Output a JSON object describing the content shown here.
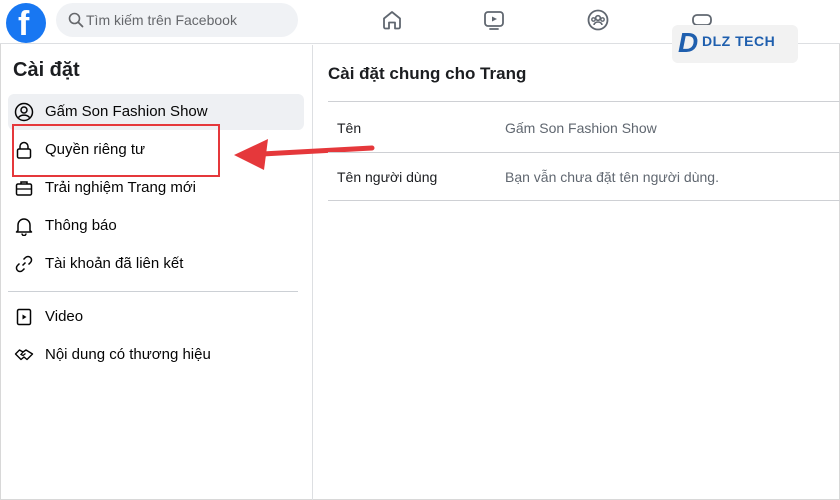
{
  "header": {
    "logo": "f",
    "search_placeholder": "Tìm kiếm trên Facebook",
    "nav_icons": [
      "home-icon",
      "watch-icon",
      "groups-icon",
      "gaming-icon"
    ]
  },
  "watermark": {
    "mark": "D",
    "text": "DLZ TECH"
  },
  "sidebar": {
    "title": "Cài đặt",
    "items": [
      {
        "label": "Gấm Son Fashion Show",
        "icon": "user-circle-icon",
        "active": true
      },
      {
        "label": "Quyền riêng tư",
        "icon": "lock-icon"
      },
      {
        "label": "Trải nghiệm Trang mới",
        "icon": "briefcase-icon"
      },
      {
        "label": "Thông báo",
        "icon": "bell-icon"
      },
      {
        "label": "Tài khoản đã liên kết",
        "icon": "link-icon"
      },
      {
        "label": "Video",
        "icon": "video-icon"
      },
      {
        "label": "Nội dung có thương hiệu",
        "icon": "handshake-icon"
      }
    ]
  },
  "main": {
    "title": "Cài đặt chung cho Trang",
    "rows": [
      {
        "label": "Tên",
        "value": "Gấm Son Fashion Show"
      },
      {
        "label": "Tên người dùng",
        "value": "Bạn vẫn chưa đặt tên người dùng."
      }
    ]
  },
  "colors": {
    "facebook_blue": "#1877f2",
    "highlight_red": "#e5383b",
    "watermark_blue": "#1f5fae"
  }
}
